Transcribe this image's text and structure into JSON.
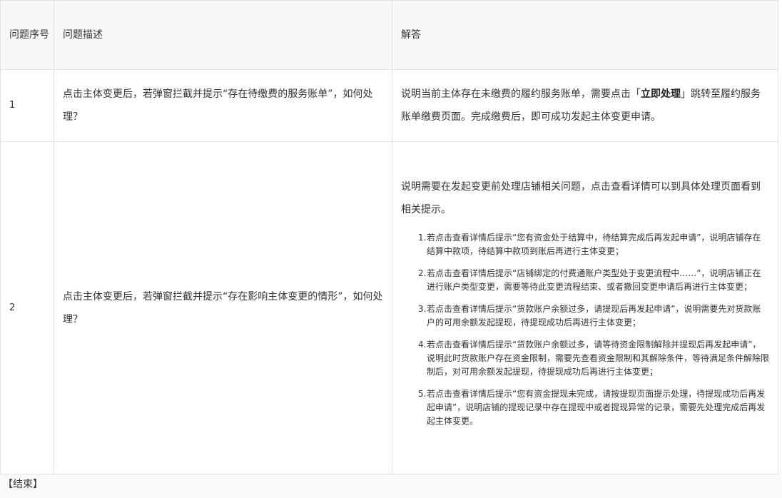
{
  "table": {
    "headers": {
      "col_no": "问题序号",
      "col_desc": "问题描述",
      "col_answer": "解答"
    },
    "rows": [
      {
        "no": "1",
        "desc": "点击主体变更后，若弹窗拦截并提示“存在待缴费的服务账单”，如何处理？",
        "answer_pre": "说明当前主体存在未缴费的履约服务账单，需要点击「",
        "answer_bold": "立即处理",
        "answer_post": "」跳转至履约服务账单缴费页面。完成缴费后，即可成功发起主体变更申请。"
      },
      {
        "no": "2",
        "desc": "点击主体变更后，若弹窗拦截并提示“存在影响主体变更的情形”，如何处理？",
        "answer_intro": "说明需要在发起变更前处理店铺相关问题，点击查看详情可以到具体处理页面看到相关提示。",
        "items": [
          {
            "idx": "1.",
            "text": "若点击查看详情后提示“您有资金处于结算中，待结算完成后再发起申请”，说明店铺存在结算中款项，待结算中款项到账后再进行主体变更；"
          },
          {
            "idx": "2.",
            "text": "若点击查看详情后提示“店铺绑定的付费通账户类型处于变更流程中……”，说明店铺正在进行账户类型变更，需要等待此变更流程结束、或者撤回变更申请后再进行主体变更；"
          },
          {
            "idx": "3.",
            "text": "若点击查看详情后提示“货款账户余额过多，请提现后再发起申请”，说明需要先对货款账户的可用余额发起提现，待提现成功后再进行主体变更；"
          },
          {
            "idx": "4.",
            "text": "若点击查看详情后提示“货款账户余额过多，请等待资金限制解除并提现后再发起申请”，说明此时货款账户存在资金限制，需要先查看资金限制和其解除条件，等待满足条件解除限制后，对可用余额发起提现，待提现成功后再进行主体变更；"
          },
          {
            "idx": "5.",
            "text": "若点击查看详情后提示“您有资金提现未完成，请按提现页面提示处理，待提现成功后再发起申请”，说明店铺的提现记录中存在提现中或者提现异常的记录，需要先处理完成后再发起主体变更。"
          }
        ]
      }
    ]
  },
  "footer": {
    "text": "【结束】"
  }
}
